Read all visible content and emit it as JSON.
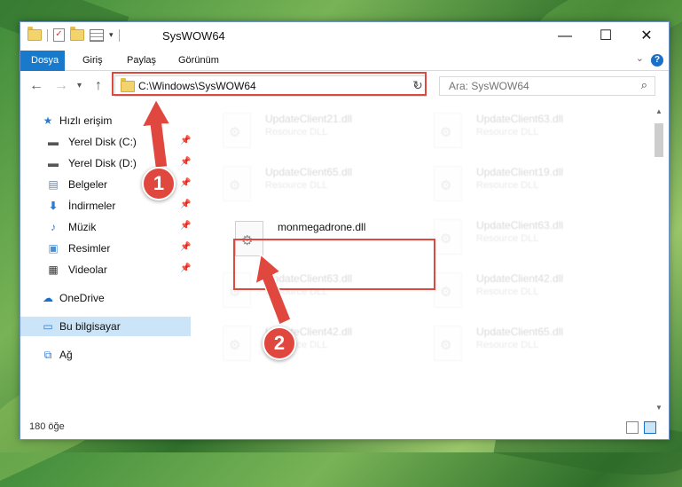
{
  "window": {
    "title": "SysWOW64",
    "controls": {
      "minimize": "—",
      "maximize": "☐",
      "close": "✕"
    }
  },
  "ribbon": {
    "tabs": [
      "Dosya",
      "Giriş",
      "Paylaş",
      "Görünüm"
    ],
    "help": "?"
  },
  "address": {
    "path": "C:\\Windows\\SysWOW64",
    "search_placeholder": "Ara: SysWOW64"
  },
  "sidebar": {
    "items": [
      {
        "label": "Hızlı erişim",
        "icon": "star-icon"
      },
      {
        "label": "Yerel Disk (C:)",
        "icon": "drive-icon",
        "pinned": true
      },
      {
        "label": "Yerel Disk (D:)",
        "icon": "drive-icon",
        "pinned": true
      },
      {
        "label": "Belgeler",
        "icon": "documents-icon",
        "pinned": true
      },
      {
        "label": "İndirmeler",
        "icon": "download-icon",
        "pinned": true
      },
      {
        "label": "Müzik",
        "icon": "music-icon",
        "pinned": true
      },
      {
        "label": "Resimler",
        "icon": "pictures-icon",
        "pinned": true
      },
      {
        "label": "Videolar",
        "icon": "videos-icon",
        "pinned": true
      },
      {
        "label": "OneDrive",
        "icon": "cloud-icon"
      },
      {
        "label": "Bu bilgisayar",
        "icon": "computer-icon",
        "selected": true
      },
      {
        "label": "Ağ",
        "icon": "network-icon"
      }
    ]
  },
  "files": {
    "left": [
      {
        "name": "UpdateClient21.dll",
        "type": "Resource DLL"
      },
      {
        "name": "UpdateClient65.dll",
        "type": "Resource DLL"
      },
      {
        "name": "monmegadrone.dll",
        "type": ""
      },
      {
        "name": "UpdateClient63.dll",
        "type": "Resource DLL"
      },
      {
        "name": "UpdateClient42.dll",
        "type": "Resource DLL"
      }
    ],
    "right": [
      {
        "name": "UpdateClient63.dll",
        "type": "Resource DLL"
      },
      {
        "name": "UpdateClient19.dll",
        "type": "Resource DLL"
      },
      {
        "name": "UpdateClient63.dll",
        "type": "Resource DLL"
      },
      {
        "name": "UpdateClient42.dll",
        "type": "Resource DLL"
      },
      {
        "name": "UpdateClient65.dll",
        "type": "Resource DLL"
      }
    ]
  },
  "annotations": {
    "step1": "1",
    "step2": "2",
    "color": "#e0473e"
  },
  "status": {
    "count": "180 öğe"
  }
}
